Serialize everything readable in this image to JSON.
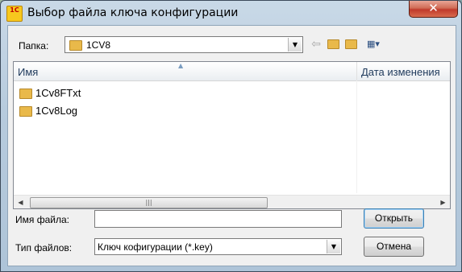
{
  "window": {
    "title": "Выбор файла ключа конфигурации",
    "app_icon_text": "1C",
    "close_label": "✕"
  },
  "location": {
    "label": "Папка:",
    "current_folder": "1CV8"
  },
  "toolbar": {
    "icons": [
      "back-arrow-icon",
      "up-folder-icon",
      "new-folder-icon",
      "view-menu-icon"
    ]
  },
  "file_list": {
    "columns": [
      "Имя",
      "Дата изменения"
    ],
    "items": [
      {
        "name": "1Cv8FTxt"
      },
      {
        "name": "1Cv8Log"
      }
    ]
  },
  "file_name": {
    "label": "Имя файла:",
    "value": ""
  },
  "file_type": {
    "label": "Тип файлов:",
    "value": "Ключ кофигурации (*.key)"
  },
  "buttons": {
    "open": "Открыть",
    "cancel": "Отмена"
  },
  "scrollbar": {
    "thumb_glyph": "|||"
  }
}
